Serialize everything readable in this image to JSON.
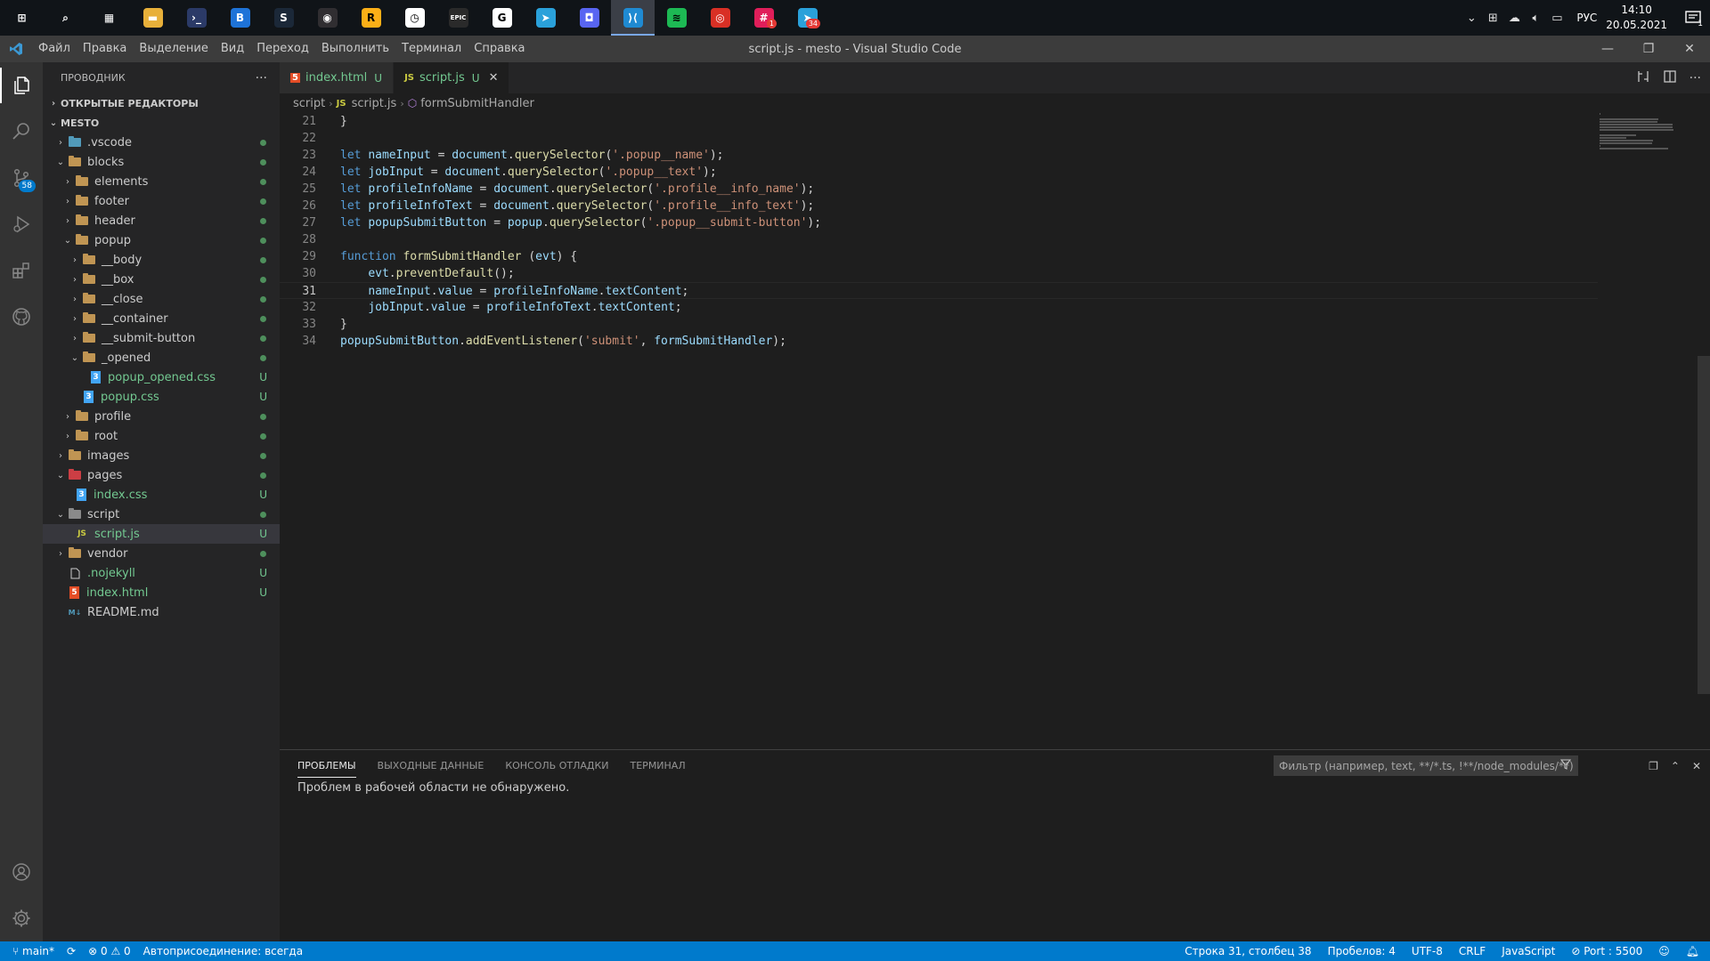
{
  "taskbar": {
    "apps": [
      {
        "name": "windows-start",
        "glyph": "⊞",
        "color": "#ffffff",
        "bg": "transparent"
      },
      {
        "name": "search",
        "glyph": "⌕",
        "color": "#ffffff",
        "bg": "transparent"
      },
      {
        "name": "task-view",
        "glyph": "▦",
        "color": "#ffffff",
        "bg": "transparent"
      },
      {
        "name": "file-explorer",
        "glyph": "▬",
        "color": "#ffffff",
        "bg": "#e8b03a"
      },
      {
        "name": "terminal",
        "glyph": "›_",
        "color": "#ffffff",
        "bg": "#2b3a67"
      },
      {
        "name": "app-b",
        "glyph": "B",
        "color": "#ffffff",
        "bg": "#1e73d8"
      },
      {
        "name": "steam",
        "glyph": "S",
        "color": "#ffffff",
        "bg": "#1b2838"
      },
      {
        "name": "obs",
        "glyph": "◉",
        "color": "#ffffff",
        "bg": "#302e31"
      },
      {
        "name": "rockstar",
        "glyph": "R",
        "color": "#000000",
        "bg": "#fcaf17"
      },
      {
        "name": "app-clock",
        "glyph": "◷",
        "color": "#000000",
        "bg": "#ffffff"
      },
      {
        "name": "epic-games",
        "glyph": "EPIC",
        "color": "#ffffff",
        "bg": "#2a2a2a"
      },
      {
        "name": "gog",
        "glyph": "G",
        "color": "#000000",
        "bg": "#ffffff"
      },
      {
        "name": "telegram",
        "glyph": "➤",
        "color": "#ffffff",
        "bg": "#2aa1da"
      },
      {
        "name": "discord",
        "glyph": "◘",
        "color": "#ffffff",
        "bg": "#5865f2"
      },
      {
        "name": "vscode",
        "glyph": "⟩⟨",
        "color": "#ffffff",
        "bg": "#1f8ad2"
      },
      {
        "name": "spotify",
        "glyph": "≋",
        "color": "#000000",
        "bg": "#1db954"
      },
      {
        "name": "chrome",
        "glyph": "◎",
        "color": "#ffffff",
        "bg": "#d93025"
      },
      {
        "name": "slack",
        "glyph": "#",
        "color": "#ffffff",
        "bg": "#e01e5a",
        "badge": "1"
      },
      {
        "name": "telegram-2",
        "glyph": "➤",
        "color": "#ffffff",
        "bg": "#2aa1da",
        "badge": "34"
      }
    ],
    "active_app_index": 14,
    "language": "РУС",
    "time": "14:10",
    "date": "20.05.2021",
    "notification_count": "1"
  },
  "titlebar": {
    "menu": [
      "Файл",
      "Правка",
      "Выделение",
      "Вид",
      "Переход",
      "Выполнить",
      "Терминал",
      "Справка"
    ],
    "title": "script.js - mesto - Visual Studio Code"
  },
  "activitybar": {
    "scm_badge": "58"
  },
  "sidebar": {
    "title": "ПРОВОДНИК",
    "more": "···",
    "open_editors": "ОТКРЫТЫЕ РЕДАКТОРЫ",
    "project": "MESTO",
    "tree": [
      {
        "label": ".vscode",
        "depth": 0,
        "type": "folder",
        "open": false,
        "icon": "blue",
        "status": "dot"
      },
      {
        "label": "blocks",
        "depth": 0,
        "type": "folder",
        "open": true,
        "icon": "yellow",
        "status": "dot"
      },
      {
        "label": "elements",
        "depth": 1,
        "type": "folder",
        "open": false,
        "icon": "yellow",
        "status": "dot"
      },
      {
        "label": "footer",
        "depth": 1,
        "type": "folder",
        "open": false,
        "icon": "yellow",
        "status": "dot"
      },
      {
        "label": "header",
        "depth": 1,
        "type": "folder",
        "open": false,
        "icon": "yellow",
        "status": "dot"
      },
      {
        "label": "popup",
        "depth": 1,
        "type": "folder",
        "open": true,
        "icon": "yellow",
        "status": "dot"
      },
      {
        "label": "__body",
        "depth": 2,
        "type": "folder",
        "open": false,
        "icon": "yellow",
        "status": "dot"
      },
      {
        "label": "__box",
        "depth": 2,
        "type": "folder",
        "open": false,
        "icon": "yellow",
        "status": "dot"
      },
      {
        "label": "__close",
        "depth": 2,
        "type": "folder",
        "open": false,
        "icon": "yellow",
        "status": "dot"
      },
      {
        "label": "__container",
        "depth": 2,
        "type": "folder",
        "open": false,
        "icon": "yellow",
        "status": "dot"
      },
      {
        "label": "__submit-button",
        "depth": 2,
        "type": "folder",
        "open": false,
        "icon": "yellow",
        "status": "dot"
      },
      {
        "label": "_opened",
        "depth": 2,
        "type": "folder",
        "open": true,
        "icon": "yellow",
        "status": "dot"
      },
      {
        "label": "popup_opened.css",
        "depth": 3,
        "type": "css",
        "status": "U"
      },
      {
        "label": "popup.css",
        "depth": 2,
        "type": "css",
        "status": "U"
      },
      {
        "label": "profile",
        "depth": 1,
        "type": "folder",
        "open": false,
        "icon": "yellow",
        "status": "dot"
      },
      {
        "label": "root",
        "depth": 1,
        "type": "folder",
        "open": false,
        "icon": "yellow",
        "status": "dot"
      },
      {
        "label": "images",
        "depth": 0,
        "type": "folder",
        "open": false,
        "icon": "yellow",
        "status": "dot"
      },
      {
        "label": "pages",
        "depth": 0,
        "type": "folder",
        "open": true,
        "icon": "red",
        "status": "dot"
      },
      {
        "label": "index.css",
        "depth": 1,
        "type": "css",
        "status": "U"
      },
      {
        "label": "script",
        "depth": 0,
        "type": "folder",
        "open": true,
        "icon": "grey",
        "status": "dot"
      },
      {
        "label": "script.js",
        "depth": 1,
        "type": "js",
        "status": "U",
        "selected": true
      },
      {
        "label": "vendor",
        "depth": 0,
        "type": "folder",
        "open": false,
        "icon": "yellow",
        "status": "dot"
      },
      {
        "label": ".nojekyll",
        "depth": 0,
        "type": "file",
        "status": "U"
      },
      {
        "label": "index.html",
        "depth": 0,
        "type": "html",
        "status": "U"
      },
      {
        "label": "README.md",
        "depth": 0,
        "type": "md",
        "status": ""
      }
    ]
  },
  "editor": {
    "tabs": [
      {
        "label": "index.html",
        "icon": "html",
        "modified": "U",
        "active": false
      },
      {
        "label": "script.js",
        "icon": "js",
        "modified": "U",
        "active": true,
        "close": "✕"
      }
    ],
    "breadcrumb": {
      "folder": "script",
      "file": "script.js",
      "symbol": "formSubmitHandler"
    },
    "current_line": 31,
    "lines": [
      {
        "n": 21,
        "tokens": [
          [
            "p",
            "}"
          ]
        ]
      },
      {
        "n": 22,
        "tokens": []
      },
      {
        "n": 23,
        "tokens": [
          [
            "kw",
            "let"
          ],
          [
            "p",
            " "
          ],
          [
            "var",
            "nameInput"
          ],
          [
            "p",
            " = "
          ],
          [
            "var",
            "document"
          ],
          [
            "p",
            "."
          ],
          [
            "fn",
            "querySelector"
          ],
          [
            "p",
            "("
          ],
          [
            "str",
            "'.popup__name'"
          ],
          [
            "p",
            ");"
          ]
        ]
      },
      {
        "n": 24,
        "tokens": [
          [
            "kw",
            "let"
          ],
          [
            "p",
            " "
          ],
          [
            "var",
            "jobInput"
          ],
          [
            "p",
            " = "
          ],
          [
            "var",
            "document"
          ],
          [
            "p",
            "."
          ],
          [
            "fn",
            "querySelector"
          ],
          [
            "p",
            "("
          ],
          [
            "str",
            "'.popup__text'"
          ],
          [
            "p",
            ");"
          ]
        ]
      },
      {
        "n": 25,
        "tokens": [
          [
            "kw",
            "let"
          ],
          [
            "p",
            " "
          ],
          [
            "var",
            "profileInfoName"
          ],
          [
            "p",
            " = "
          ],
          [
            "var",
            "document"
          ],
          [
            "p",
            "."
          ],
          [
            "fn",
            "querySelector"
          ],
          [
            "p",
            "("
          ],
          [
            "str",
            "'.profile__info_name'"
          ],
          [
            "p",
            ");"
          ]
        ]
      },
      {
        "n": 26,
        "tokens": [
          [
            "kw",
            "let"
          ],
          [
            "p",
            " "
          ],
          [
            "var",
            "profileInfoText"
          ],
          [
            "p",
            " = "
          ],
          [
            "var",
            "document"
          ],
          [
            "p",
            "."
          ],
          [
            "fn",
            "querySelector"
          ],
          [
            "p",
            "("
          ],
          [
            "str",
            "'.profile__info_text'"
          ],
          [
            "p",
            ");"
          ]
        ]
      },
      {
        "n": 27,
        "tokens": [
          [
            "kw",
            "let"
          ],
          [
            "p",
            " "
          ],
          [
            "var",
            "popupSubmitButton"
          ],
          [
            "p",
            " = "
          ],
          [
            "var",
            "popup"
          ],
          [
            "p",
            "."
          ],
          [
            "fn",
            "querySelector"
          ],
          [
            "p",
            "("
          ],
          [
            "str",
            "'.popup__submit-button'"
          ],
          [
            "p",
            ");"
          ]
        ]
      },
      {
        "n": 28,
        "tokens": []
      },
      {
        "n": 29,
        "tokens": [
          [
            "kw",
            "function"
          ],
          [
            "p",
            " "
          ],
          [
            "fn",
            "formSubmitHandler"
          ],
          [
            "p",
            " ("
          ],
          [
            "var",
            "evt"
          ],
          [
            "p",
            ") {"
          ]
        ]
      },
      {
        "n": 30,
        "tokens": [
          [
            "p",
            "    "
          ],
          [
            "var",
            "evt"
          ],
          [
            "p",
            "."
          ],
          [
            "fn",
            "preventDefault"
          ],
          [
            "p",
            "();"
          ]
        ]
      },
      {
        "n": 31,
        "tokens": [
          [
            "p",
            "    "
          ],
          [
            "var",
            "nameInput"
          ],
          [
            "p",
            "."
          ],
          [
            "var",
            "value"
          ],
          [
            "p",
            " = "
          ],
          [
            "var",
            "profileInfoName"
          ],
          [
            "p",
            "."
          ],
          [
            "var",
            "textContent"
          ],
          [
            "p",
            ";"
          ]
        ]
      },
      {
        "n": 32,
        "tokens": [
          [
            "p",
            "    "
          ],
          [
            "var",
            "jobInput"
          ],
          [
            "p",
            "."
          ],
          [
            "var",
            "value"
          ],
          [
            "p",
            " = "
          ],
          [
            "var",
            "profileInfoText"
          ],
          [
            "p",
            "."
          ],
          [
            "var",
            "textContent"
          ],
          [
            "p",
            ";"
          ]
        ]
      },
      {
        "n": 33,
        "tokens": [
          [
            "p",
            "}"
          ]
        ]
      },
      {
        "n": 34,
        "tokens": [
          [
            "var",
            "popupSubmitButton"
          ],
          [
            "p",
            "."
          ],
          [
            "fn",
            "addEventListener"
          ],
          [
            "p",
            "("
          ],
          [
            "str",
            "'submit'"
          ],
          [
            "p",
            ", "
          ],
          [
            "var",
            "formSubmitHandler"
          ],
          [
            "p",
            ");"
          ]
        ]
      }
    ]
  },
  "panel": {
    "tabs": [
      "ПРОБЛЕМЫ",
      "ВЫХОДНЫЕ ДАННЫЕ",
      "КОНСОЛЬ ОТЛАДКИ",
      "ТЕРМИНАЛ"
    ],
    "active_tab": 0,
    "filter_placeholder": "Фильтр (например, text, **/*.ts, !**/node_modules/**)",
    "message": "Проблем в рабочей области не обнаружено."
  },
  "statusbar": {
    "branch": "main*",
    "errors": "0",
    "warnings": "0",
    "live_share": "Автоприсоединение: всегда",
    "position": "Строка 31, столбец 38",
    "spaces": "Пробелов: 4",
    "encoding": "UTF-8",
    "eol": "CRLF",
    "language": "JavaScript",
    "port": "Port : 5500"
  },
  "colors": {
    "accent": "#007acc",
    "git_untracked": "#73c991",
    "git_dot": "#4e8f5c"
  }
}
